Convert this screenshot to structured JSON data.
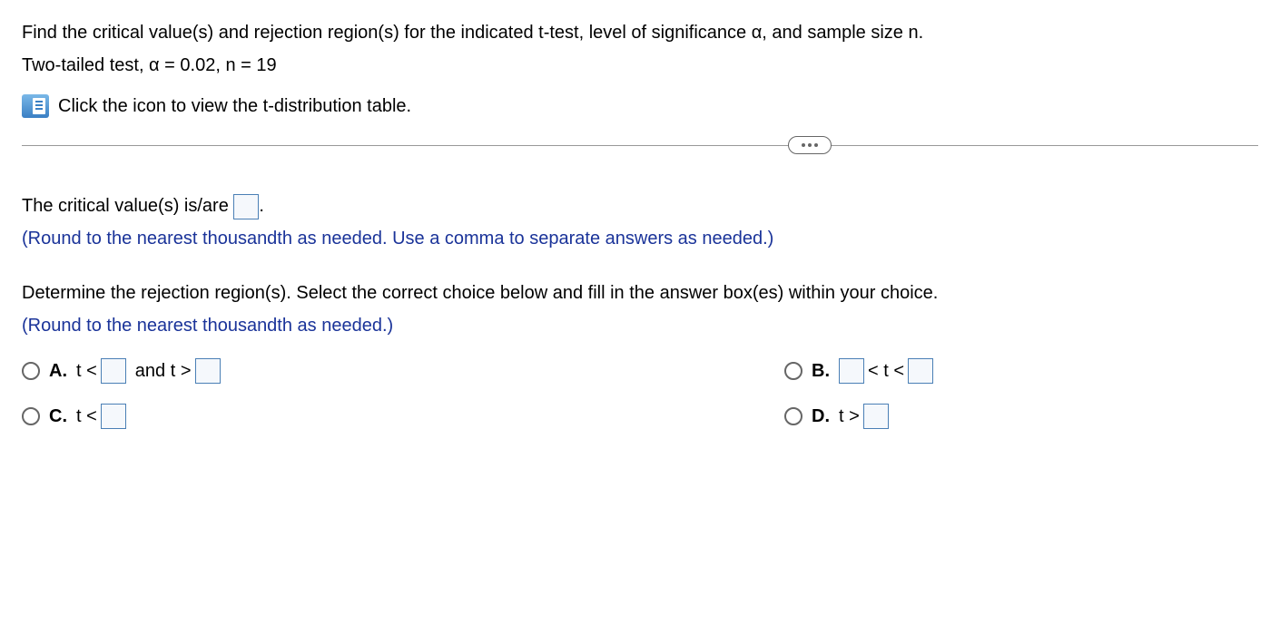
{
  "question": {
    "line1": "Find the critical value(s) and rejection region(s) for the indicated t-test, level of significance α, and sample size n.",
    "line2": "Two-tailed test, α = 0.02, n = 19",
    "iconLine": "Click the icon to view the t-distribution table."
  },
  "part1": {
    "prompt_before": "The critical value(s) is/are ",
    "prompt_after": ".",
    "hint": "(Round to the nearest thousandth as needed. Use a comma to separate answers as needed.)"
  },
  "part2": {
    "prompt": "Determine the rejection region(s). Select the correct choice below and fill in the answer box(es) within your choice.",
    "hint": "(Round to the nearest thousandth as needed.)",
    "choices": {
      "a": {
        "label": "A.",
        "text1": "t <",
        "text2": "and t >"
      },
      "b": {
        "label": "B.",
        "text1": "< t <"
      },
      "c": {
        "label": "C.",
        "text1": "t <"
      },
      "d": {
        "label": "D.",
        "text1": "t >"
      }
    }
  }
}
